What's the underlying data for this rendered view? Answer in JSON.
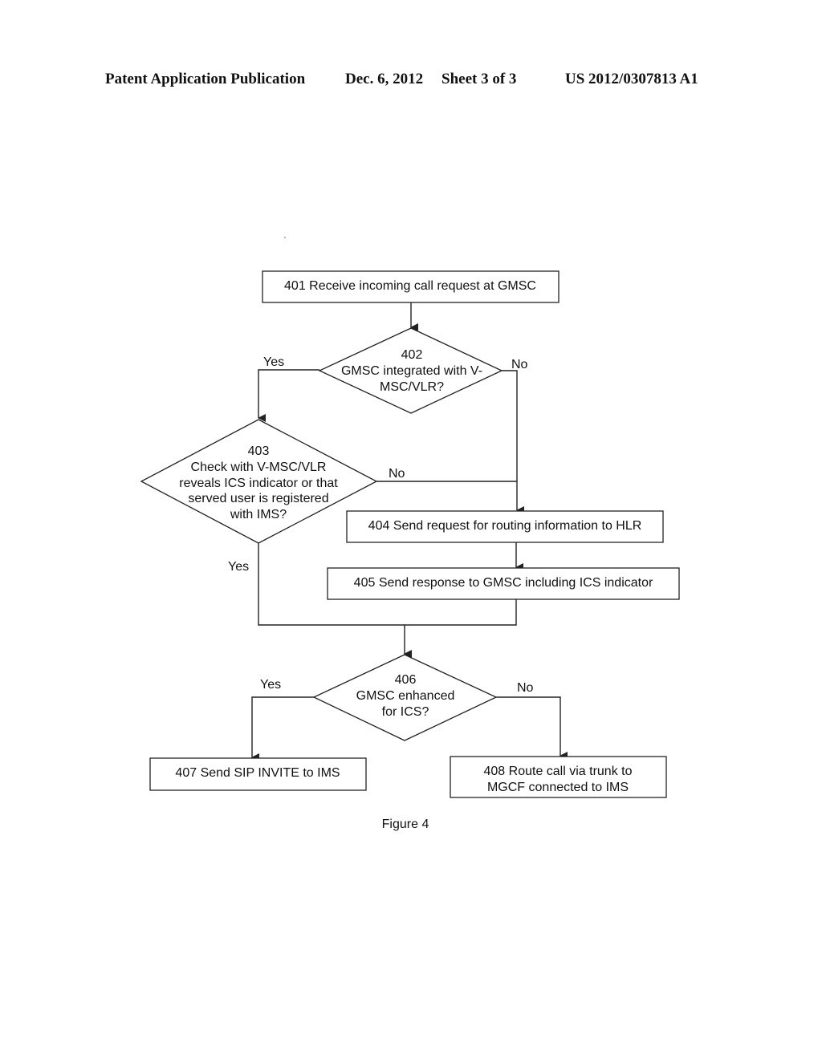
{
  "header": {
    "publication": "Patent Application Publication",
    "date": "Dec. 6, 2012",
    "sheet": "Sheet 3 of 3",
    "number": "US 2012/0307813 A1"
  },
  "flowchart": {
    "nodes": {
      "n401": {
        "type": "process",
        "lines": [
          "401 Receive incoming call request at GMSC"
        ]
      },
      "n402": {
        "type": "decision",
        "lines": [
          "402",
          "GMSC integrated with V-",
          "MSC/VLR?"
        ]
      },
      "n403": {
        "type": "decision",
        "lines": [
          "403",
          "Check with V-MSC/VLR",
          "reveals ICS indicator or that",
          "served user is registered",
          "with IMS?"
        ]
      },
      "n404": {
        "type": "process",
        "lines": [
          "404 Send request for routing information to HLR"
        ]
      },
      "n405": {
        "type": "process",
        "lines": [
          "405 Send response to GMSC including ICS indicator"
        ]
      },
      "n406": {
        "type": "decision",
        "lines": [
          "406",
          "GMSC enhanced",
          "for ICS?"
        ]
      },
      "n407": {
        "type": "process",
        "lines": [
          "407 Send SIP INVITE to IMS"
        ]
      },
      "n408": {
        "type": "process",
        "lines": [
          "408 Route call via trunk to",
          "MGCF connected to IMS"
        ]
      }
    },
    "edges": [
      {
        "from": "401",
        "to": "402",
        "label": ""
      },
      {
        "from": "402",
        "to": "403",
        "label": "Yes"
      },
      {
        "from": "402",
        "to": "404",
        "label": "No"
      },
      {
        "from": "403",
        "to": "404",
        "label": "No"
      },
      {
        "from": "403",
        "to": "406",
        "label": "Yes"
      },
      {
        "from": "404",
        "to": "405",
        "label": ""
      },
      {
        "from": "405",
        "to": "406",
        "label": ""
      },
      {
        "from": "406",
        "to": "407",
        "label": "Yes"
      },
      {
        "from": "406",
        "to": "408",
        "label": "No"
      }
    ],
    "labels": {
      "yes_402": "Yes",
      "no_402": "No",
      "no_403": "No",
      "yes_403": "Yes",
      "yes_406": "Yes",
      "no_406": "No"
    }
  },
  "caption": "Figure 4"
}
